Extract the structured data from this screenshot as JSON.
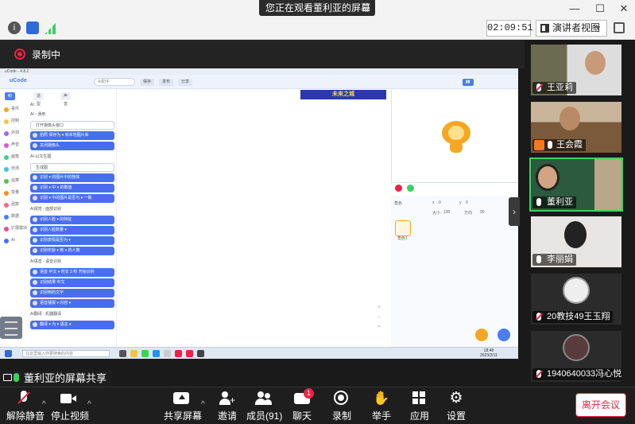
{
  "window": {
    "share_notice": "您正在观看董利亚的屏幕",
    "controls": [
      "—",
      "☐",
      "✕"
    ]
  },
  "toolbar": {
    "timer": "02:09:51",
    "view_button": "演讲者视图"
  },
  "recording": {
    "label": "录制中"
  },
  "shared_screen": {
    "window_title": "uCode - 4.8.2",
    "app_logo": "uCode",
    "search_placeholder": "AI助手",
    "nav_buttons": [
      "保存",
      "发布",
      "分享"
    ],
    "tabs": [
      "积木",
      "造型",
      "声音"
    ],
    "categories": [
      {
        "label": "事件",
        "color": "#f5a623"
      },
      {
        "label": "控制",
        "color": "#f5c542"
      },
      {
        "label": "外观",
        "color": "#9a66ff"
      },
      {
        "label": "声音",
        "color": "#d65cd6"
      },
      {
        "label": "画笔",
        "color": "#3ecf8e"
      },
      {
        "label": "侦测",
        "color": "#4cbfe6"
      },
      {
        "label": "运算",
        "color": "#59c059"
      },
      {
        "label": "变量",
        "color": "#ff8c1a"
      },
      {
        "label": "函数",
        "color": "#ff6680"
      },
      {
        "label": "数据",
        "color": "#4a7df0"
      },
      {
        "label": "扩展模块",
        "color": "#e94b8b"
      },
      {
        "label": "AI",
        "color": "#4a6df0"
      }
    ],
    "palette": [
      {
        "type": "section",
        "text": "AI"
      },
      {
        "type": "section",
        "text": "AI - 通用"
      },
      {
        "type": "outline",
        "text": "打开摄像头窗口"
      },
      {
        "type": "block",
        "text": "拍照 保存为 ▾ 到本地图片库"
      },
      {
        "type": "block",
        "text": "关闭摄像头"
      },
      {
        "type": "section",
        "text": "AI-以文生图"
      },
      {
        "type": "outline",
        "text": "生成图"
      },
      {
        "type": "block",
        "text": "识别 ▾ 的图片中的物体"
      },
      {
        "type": "block",
        "text": "识别 ▾ 中 ▾ 的数值"
      },
      {
        "type": "block",
        "text": "识别 ▾ 中的图片是否与 ▾ 一致"
      },
      {
        "type": "section",
        "text": "AI视觉 - 面部识别"
      },
      {
        "type": "block",
        "text": "识别人脸 ▾ 的特征"
      },
      {
        "type": "block",
        "text": "识别人脸数量 ▾"
      },
      {
        "type": "block",
        "text": "识别表情是否为 ▾"
      },
      {
        "type": "block",
        "text": "识别年龄 ▾ 到 ▾ 的人数"
      },
      {
        "type": "section",
        "text": "AI语音 - 语音识别"
      },
      {
        "type": "block",
        "text": "语音 中文 ▾ 时长 3 秒 开始识别"
      },
      {
        "type": "block",
        "text": "识别结果 中文"
      },
      {
        "type": "block",
        "text": "识别到的文字"
      },
      {
        "type": "block",
        "text": "语音播报 ▾ 内容 ▾"
      },
      {
        "type": "section",
        "text": "AI翻译 - 机器翻译"
      },
      {
        "type": "block",
        "text": "翻译 ▾ 为 ▾ 语言 ▾"
      }
    ],
    "banner": "未来之城",
    "sprite_props": {
      "name_label": "角色",
      "x_label": "x",
      "x_value": "0",
      "y_label": "y",
      "y_value": "0",
      "size_label": "大小",
      "size_value": "100",
      "direction_label": "方向",
      "direction_value": "90"
    },
    "sprite_name": "角色1",
    "taskbar_search_placeholder": "在这里输入你要搜索的内容",
    "clock_time": "18:48",
    "clock_date": "2023/2/11"
  },
  "sharer_label": "董利亚的屏幕共享",
  "participants": [
    {
      "name": "王亚莉",
      "muted": true,
      "host": false,
      "speaking": false
    },
    {
      "name": "王会霞",
      "muted": false,
      "host": true,
      "speaking": false
    },
    {
      "name": "董利亚",
      "muted": false,
      "host": false,
      "speaking": true
    },
    {
      "name": "李丽娟",
      "muted": false,
      "host": false,
      "speaking": false
    },
    {
      "name": "20教技49王玉翔",
      "muted": true,
      "host": false,
      "speaking": false
    },
    {
      "name": "1940640033冯心悦",
      "muted": true,
      "host": false,
      "speaking": false
    }
  ],
  "bottom_bar": {
    "mute": "解除静音",
    "video": "停止视频",
    "share": "共享屏幕",
    "invite": "邀请",
    "members": "成员(91)",
    "chat": "聊天",
    "chat_badge": "1",
    "record": "录制",
    "raise_hand": "举手",
    "apps": "应用",
    "settings": "设置",
    "leave": "离开会议"
  },
  "colors": {
    "accent_blue": "#4a7df0",
    "speaking_green": "#3ecf5f",
    "recording_red": "#e24",
    "host_orange": "#f07a2a"
  }
}
